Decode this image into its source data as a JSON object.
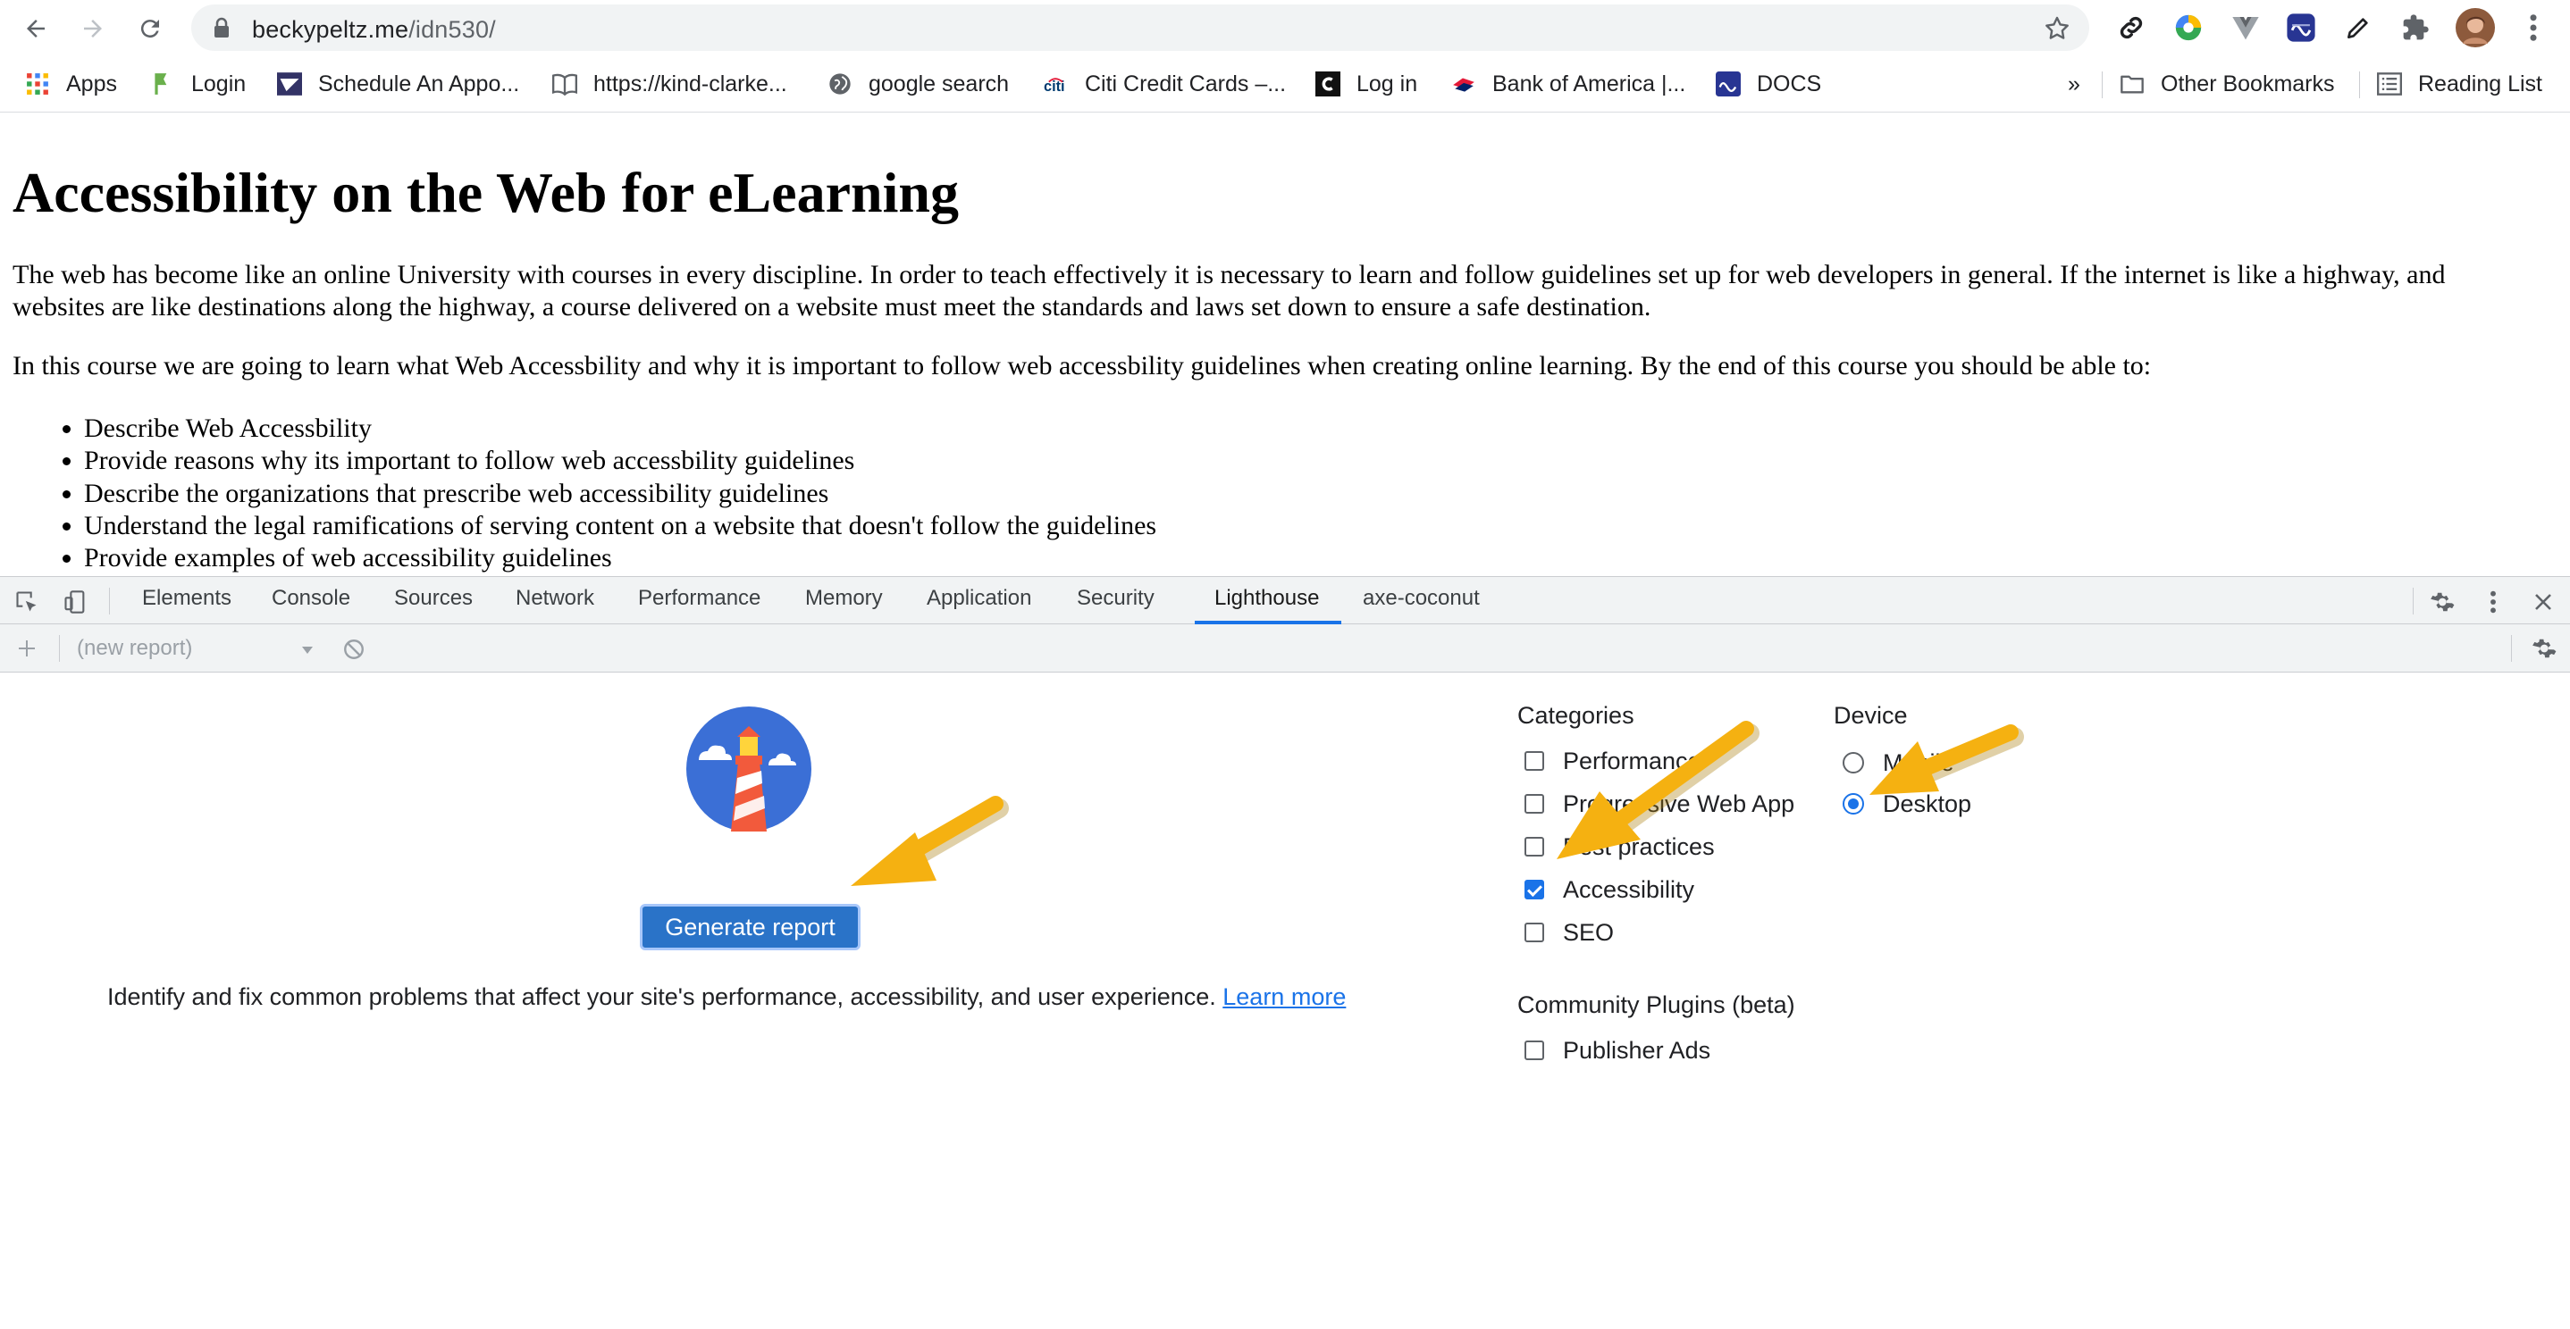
{
  "browser": {
    "url_host": "beckypeltz.me",
    "url_path": "/idn530/",
    "bookmarks": [
      {
        "label": "Apps",
        "icon": "apps-grid-icon"
      },
      {
        "label": "Login",
        "icon": "login-bookmark-icon"
      },
      {
        "label": "Schedule An Appo...",
        "icon": "usps-icon"
      },
      {
        "label": "https://kind-clarke...",
        "icon": "book-icon"
      },
      {
        "label": "google search",
        "icon": "globe-icon"
      },
      {
        "label": "Citi Credit Cards –...",
        "icon": "citi-icon"
      },
      {
        "label": "Log in",
        "icon": "login-c-icon"
      },
      {
        "label": "Bank of America |...",
        "icon": "bank-of-america-icon"
      },
      {
        "label": "DOCS",
        "icon": "docs-icon"
      }
    ],
    "overflow_label": "»",
    "other_bookmarks": "Other Bookmarks",
    "reading_list": "Reading List"
  },
  "page": {
    "title": "Accessibility on the Web for eLearning",
    "paragraph1": "The web has become like an online University with courses in every discipline. In order to teach effectively it is necessary to learn and follow guidelines set up for web developers in general. If the internet is like a highway, and websites are like destinations along the highway, a course delivered on a website must meet the standards and laws set down to ensure a safe destination.",
    "paragraph2": "In this course we are going to learn what Web Accessbility and why it is important to follow web accessbility guidelines when creating online learning. By the end of this course you should be able to:",
    "objectives": [
      "Describe Web Accessbility",
      "Provide reasons why its important to follow web accessbility guidelines",
      "Describe the organizations that prescribe web accessibility guidelines",
      "Understand the legal ramifications of serving content on a website that doesn't follow the guidelines",
      "Provide examples of web accessibility guidelines"
    ]
  },
  "devtools": {
    "tabs": [
      "Elements",
      "Console",
      "Sources",
      "Network",
      "Performance",
      "Memory",
      "Application",
      "Security",
      "Lighthouse",
      "axe-coconut"
    ],
    "active_tab": "Lighthouse",
    "report_select": "(new report)"
  },
  "lighthouse": {
    "generate_button": "Generate report",
    "description": "Identify and fix common problems that affect your site's performance, accessibility, and user experience.",
    "learn_more": "Learn more",
    "categories_title": "Categories",
    "categories": [
      {
        "label": "Performance",
        "checked": false
      },
      {
        "label": "Progressive Web App",
        "checked": false
      },
      {
        "label": "Best practices",
        "checked": false
      },
      {
        "label": "Accessibility",
        "checked": true
      },
      {
        "label": "SEO",
        "checked": false
      }
    ],
    "plugins_title": "Community Plugins (beta)",
    "plugins": [
      {
        "label": "Publisher Ads",
        "checked": false
      }
    ],
    "device_title": "Device",
    "devices": [
      {
        "label": "Mobile",
        "checked": false
      },
      {
        "label": "Desktop",
        "checked": true
      }
    ]
  },
  "colors": {
    "accent": "#1a73e8",
    "arrow": "#f5b111",
    "devtools_bg": "#f1f3f4"
  }
}
